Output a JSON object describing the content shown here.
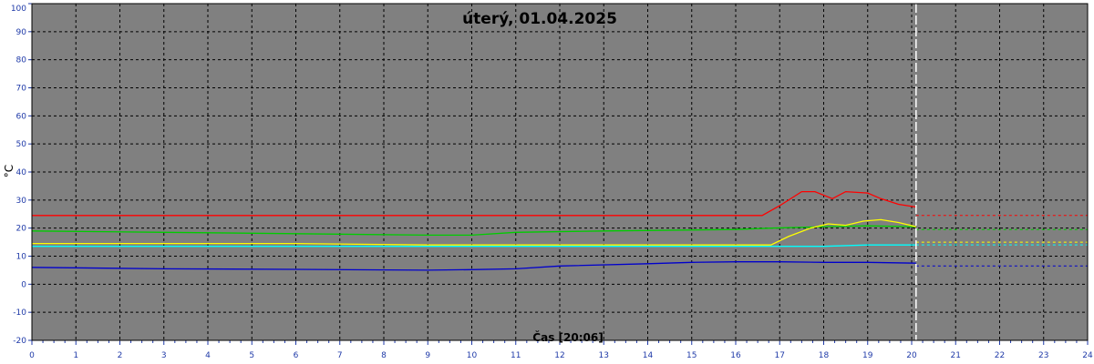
{
  "chart_data": {
    "type": "line",
    "title": "úterý, 01.04.2025",
    "xlabel": "Čas [20:06]",
    "ylabel": "°C",
    "xlim": [
      0,
      24
    ],
    "ylim": [
      -20,
      100
    ],
    "x_ticks": [
      "0",
      "1",
      "2",
      "3",
      "4",
      "5",
      "6",
      "7",
      "8",
      "9",
      "10",
      "11",
      "12",
      "13",
      "14",
      "15",
      "16",
      "17",
      "18",
      "19",
      "20",
      "21",
      "22",
      "23",
      "24"
    ],
    "y_ticks": [
      "-20",
      "-10",
      "0",
      "10",
      "20",
      "30",
      "40",
      "50",
      "60",
      "70",
      "80",
      "90",
      "100"
    ],
    "grid": true,
    "background_color": "#808080",
    "current_time": 20.1,
    "current_time_marker_color": "#ffffff",
    "series": [
      {
        "color": "#ff0000",
        "points": [
          [
            0,
            24.5
          ],
          [
            16.6,
            24.5
          ],
          [
            17.0,
            28
          ],
          [
            17.5,
            33
          ],
          [
            17.8,
            33
          ],
          [
            18.2,
            30.5
          ],
          [
            18.5,
            33
          ],
          [
            19.0,
            32.5
          ],
          [
            19.3,
            30.5
          ],
          [
            19.7,
            28.5
          ],
          [
            20.1,
            27.5
          ]
        ],
        "forecast": 24.5
      },
      {
        "color": "#00cc00",
        "points": [
          [
            0,
            19
          ],
          [
            3,
            18.5
          ],
          [
            6,
            18
          ],
          [
            9,
            17.5
          ],
          [
            10,
            17.5
          ],
          [
            11,
            18.5
          ],
          [
            13,
            19
          ],
          [
            16,
            19.5
          ],
          [
            16.8,
            20
          ],
          [
            18,
            20.5
          ],
          [
            19,
            20.8
          ],
          [
            20.1,
            20.5
          ]
        ],
        "forecast": 19.5
      },
      {
        "color": "#ffff00",
        "points": [
          [
            0,
            14.5
          ],
          [
            6,
            14.5
          ],
          [
            9,
            14
          ],
          [
            12,
            14
          ],
          [
            16.8,
            14
          ],
          [
            17.2,
            17
          ],
          [
            17.7,
            20
          ],
          [
            18.1,
            21.5
          ],
          [
            18.5,
            21
          ],
          [
            18.9,
            22.5
          ],
          [
            19.3,
            23
          ],
          [
            19.7,
            22
          ],
          [
            20.1,
            20.5
          ]
        ],
        "forecast": 15
      },
      {
        "color": "#00ffff",
        "points": [
          [
            0,
            13.5
          ],
          [
            10,
            13.5
          ],
          [
            14,
            13.5
          ],
          [
            17,
            13.5
          ],
          [
            18,
            13.5
          ],
          [
            19,
            14
          ],
          [
            20.1,
            14
          ]
        ],
        "forecast": 14
      },
      {
        "color": "#0000cc",
        "points": [
          [
            0,
            6
          ],
          [
            3,
            5.5
          ],
          [
            6,
            5.3
          ],
          [
            9,
            5
          ],
          [
            10,
            5.2
          ],
          [
            11,
            5.5
          ],
          [
            12,
            6.5
          ],
          [
            14,
            7.3
          ],
          [
            15,
            7.8
          ],
          [
            16,
            8
          ],
          [
            17,
            8
          ],
          [
            18,
            7.8
          ],
          [
            19,
            7.8
          ],
          [
            20.1,
            7.5
          ]
        ],
        "forecast": 6.5
      }
    ]
  }
}
